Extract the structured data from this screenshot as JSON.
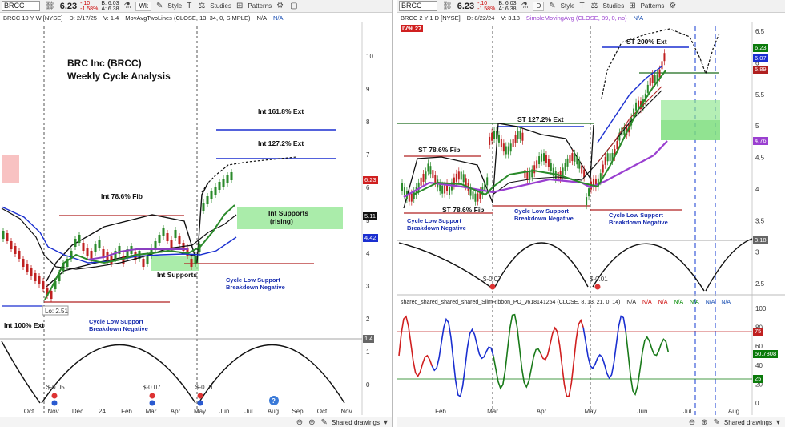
{
  "left": {
    "symbol": "BRCC",
    "price": "6.23",
    "change": "-.10",
    "change_pct": "-1.58%",
    "bid": "B: 6.03",
    "ask": "A: 6.38",
    "timeframe": "Wk",
    "style_label": "Style",
    "studies_label": "Studies",
    "patterns_label": "Patterns",
    "study_line": {
      "title": "BRCC 10 Y W [NYSE]",
      "date": "D: 2/17/25",
      "value": "V: 1.4",
      "study": "MovAvgTwoLines (CLOSE, 13, 34, 0, SIMPLE)",
      "na1": "N/A",
      "na2": "N/A"
    },
    "annotations": {
      "title1": "BRC Inc (BRCC)",
      "title2": "Weekly Cycle Analysis",
      "fib_1618": "Int 161.8% Ext",
      "fib_1272": "Int 127.2% Ext",
      "fib_786": "Int 78.6% Fib",
      "supports_rising_1": "Int Supports",
      "supports_rising_2": "(rising)",
      "int_supports": "Int Supports",
      "cycle_low_1": "Cycle Low Support",
      "cycle_low_2": "Breakdown Negative",
      "cycle_low_b1": "Cycle Low Support",
      "cycle_low_b2": "Breakdown Negative",
      "int_100": "Int 100% Ext",
      "lo": "Lo: 2.51",
      "div1": "$-0.05",
      "div2": "$-0.07",
      "div3": "$-0.01"
    },
    "price_tags": [
      {
        "text": "6.23",
        "color": "#d02020"
      },
      {
        "text": "5.11",
        "color": "#111111"
      },
      {
        "text": "4.42",
        "color": "#1a2fd0"
      },
      {
        "text": "1.4",
        "color": "#666666"
      }
    ],
    "y_ticks": [
      "10",
      "9",
      "8",
      "7",
      "6",
      "5",
      "4",
      "3",
      "2",
      "1",
      "0"
    ],
    "x_ticks": [
      "Oct",
      "Nov",
      "Dec",
      "24",
      "Feb",
      "Mar",
      "Apr",
      "May",
      "Jun",
      "Jul",
      "Aug",
      "Sep",
      "Oct",
      "Nov"
    ],
    "footer_label": "Shared drawings"
  },
  "right": {
    "symbol": "BRCC",
    "price": "6.23",
    "change": "-.10",
    "change_pct": "-1.58%",
    "bid": "B: 6.03",
    "ask": "A: 6.38",
    "timeframe": "D",
    "style_label": "Style",
    "studies_label": "Studies",
    "patterns_label": "Patterns",
    "study_line": {
      "title": "BRCC 2 Y 1 D [NYSE]",
      "date": "D: 8/22/24",
      "value": "V: 3.18",
      "study": "SimpleMovingAvg (CLOSE, 89, 0, no)",
      "na1": "N/A"
    },
    "iv_badge": "IV% 27",
    "annotations": {
      "st_200": "ST 200% Ext",
      "st_1272": "ST 127.2% Ext",
      "st_786_a": "ST 78.6% Fib",
      "st_786_b": "ST 78.6% Fib",
      "cycle_low_a1": "Cycle Low Support",
      "cycle_low_a2": "Breakdown Negative",
      "cycle_low_b1": "Cycle Low Support",
      "cycle_low_b2": "Breakdown Negative",
      "cycle_low_c1": "Cycle Low Support",
      "cycle_low_c2": "Breakdown Negative",
      "div1": "$-0.07",
      "div2": "$-0.01"
    },
    "price_tags": [
      {
        "text": "6.23",
        "color": "#0a7a0a"
      },
      {
        "text": "6.07",
        "color": "#1a2fd0"
      },
      {
        "text": "5.89",
        "color": "#b02020"
      },
      {
        "text": "4.76",
        "color": "#9a3fd0"
      },
      {
        "text": "3.18",
        "color": "#666666"
      }
    ],
    "y_ticks": [
      "6.5",
      "6",
      "5.5",
      "5",
      "4.5",
      "4",
      "3.5",
      "3",
      "2.5"
    ],
    "x_ticks": [
      "Feb",
      "Mar",
      "Apr",
      "May",
      "Jun",
      "Jul",
      "Aug"
    ],
    "lower_study": {
      "title": "shared_shared_shared_shared_SlimRibbon_PO_v618141254 (CLOSE, 8, 13, 21, 0, 14)",
      "na": [
        "N/A",
        "N/A",
        "N/A",
        "N/A",
        "N/A",
        "N/A",
        "N/A",
        "N/A",
        "N/A"
      ],
      "y_ticks": [
        "100",
        "80",
        "60",
        "40",
        "20",
        "0"
      ],
      "tags": [
        {
          "text": "75",
          "color": "#c02020"
        },
        {
          "text": "50.7808",
          "color": "#0a7a0a"
        },
        {
          "text": "25",
          "color": "#0a7a0a"
        }
      ]
    },
    "footer_label": "Shared drawings"
  },
  "chart_data": [
    {
      "type": "candlestick",
      "title": "BRC Inc (BRCC) Weekly Cycle Analysis",
      "timeframe": "weekly",
      "ylim": [
        0,
        10.5
      ],
      "levels": [
        {
          "label": "Int 161.8% Ext",
          "value": 7.75
        },
        {
          "label": "Int 127.2% Ext",
          "value": 6.9
        },
        {
          "label": "Int 78.6% Fib",
          "value": 5.2
        },
        {
          "label": "Int 100% Ext",
          "value": 2.51
        },
        {
          "label": "Cycle Low Support Breakdown Negative",
          "value": 3.75
        }
      ],
      "last_close": 6.23,
      "ma_values": [
        5.11,
        4.42
      ],
      "low": 2.51
    },
    {
      "type": "candlestick",
      "title": "BRCC 2 Y 1 D [NYSE]",
      "timeframe": "daily",
      "ylim": [
        2.3,
        6.6
      ],
      "levels": [
        {
          "label": "ST 200% Ext",
          "value": 6.2
        },
        {
          "label": "ST 127.2% Ext",
          "value": 5.0
        },
        {
          "label": "ST 78.6% Fib",
          "value": 4.5
        },
        {
          "label": "ST 78.6% Fib",
          "value": 3.75
        }
      ],
      "last_close": 6.23,
      "ma_values": [
        6.07,
        5.89,
        4.76
      ],
      "oscillator_levels": [
        75,
        25
      ],
      "oscillator_last": 50.7808
    }
  ]
}
